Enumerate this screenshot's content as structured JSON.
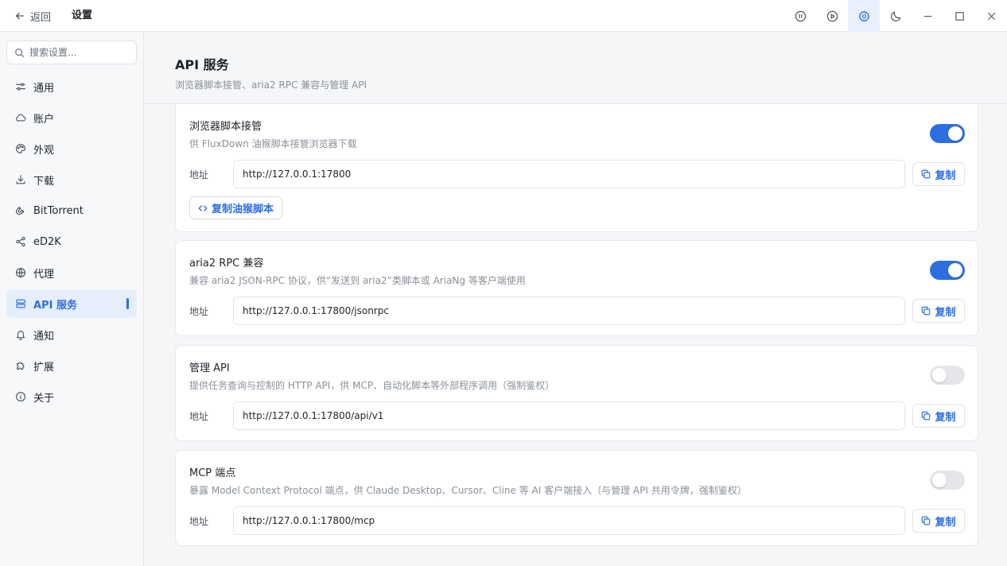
{
  "titlebar": {
    "back_label": "返回",
    "title": "设置",
    "buttons": [
      "pause-all",
      "start-all",
      "settings",
      "theme",
      "minimize",
      "maximize",
      "close"
    ]
  },
  "sidebar": {
    "search_placeholder": "搜索设置...",
    "items": [
      {
        "label": "通用",
        "icon": "sliders-icon"
      },
      {
        "label": "账户",
        "icon": "cloud-icon"
      },
      {
        "label": "外观",
        "icon": "palette-icon"
      },
      {
        "label": "下载",
        "icon": "download-icon"
      },
      {
        "label": "BitTorrent",
        "icon": "magnet-icon"
      },
      {
        "label": "eD2K",
        "icon": "share-icon"
      },
      {
        "label": "代理",
        "icon": "globe-icon"
      },
      {
        "label": "API 服务",
        "icon": "server-icon",
        "active": true
      },
      {
        "label": "通知",
        "icon": "bell-icon"
      },
      {
        "label": "扩展",
        "icon": "puzzle-icon"
      },
      {
        "label": "关于",
        "icon": "info-icon"
      }
    ]
  },
  "page": {
    "title": "API 服务",
    "subtitle": "浏览器脚本接管、aria2 RPC 兼容与管理 API"
  },
  "cards": [
    {
      "title": "浏览器脚本接管",
      "desc": "供 FluxDown 油猴脚本接管浏览器下载",
      "enabled": true,
      "addr_label": "地址",
      "addr": "http://127.0.0.1:17800",
      "copy_label": "复制",
      "extra_button": "复制油猴脚本"
    },
    {
      "title": "aria2 RPC 兼容",
      "desc": "兼容 aria2 JSON-RPC 协议，供“发送到 aria2”类脚本或 AriaNg 等客户端使用",
      "enabled": true,
      "addr_label": "地址",
      "addr": "http://127.0.0.1:17800/jsonrpc",
      "copy_label": "复制"
    },
    {
      "title": "管理 API",
      "desc": "提供任务查询与控制的 HTTP API，供 MCP、自动化脚本等外部程序调用（强制鉴权）",
      "enabled": false,
      "addr_label": "地址",
      "addr": "http://127.0.0.1:17800/api/v1",
      "copy_label": "复制"
    },
    {
      "title": "MCP 端点",
      "desc": "暴露 Model Context Protocol 端点，供 Claude Desktop、Cursor、Cline 等 AI 客户端接入（与管理 API 共用令牌，强制鉴权）",
      "enabled": false,
      "addr_label": "地址",
      "addr": "http://127.0.0.1:17800/mcp",
      "copy_label": "复制"
    }
  ],
  "colors": {
    "accent": "#2d6fe0",
    "toggle_off": "#e4e6ea",
    "active_nav_bg": "#e6eefc"
  }
}
